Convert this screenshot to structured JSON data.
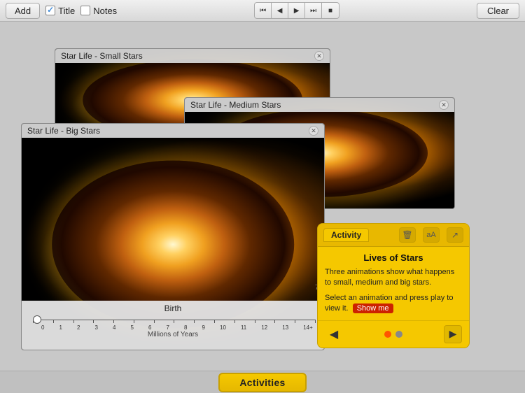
{
  "toolbar": {
    "add_label": "Add",
    "title_label": "Title",
    "notes_label": "Notes",
    "clear_label": "Clear",
    "title_checked": true,
    "notes_checked": false
  },
  "nav": {
    "buttons": [
      "⏮",
      "◀",
      "▶",
      "⏭",
      "⏹"
    ]
  },
  "panels": {
    "small": {
      "title": "Star Life - Small Stars"
    },
    "medium": {
      "title": "Star Life - Medium Stars"
    },
    "big": {
      "title": "Star Life - Big Stars",
      "timeline": {
        "label": "Birth",
        "axis_label": "Millions of Years",
        "ticks": [
          "0",
          "1",
          "2",
          "3",
          "4",
          "5",
          "6",
          "7",
          "8",
          "9",
          "10",
          "11",
          "12",
          "13",
          "14+"
        ]
      }
    }
  },
  "activity_popup": {
    "tab_label": "Activity",
    "title": "Lives of Stars",
    "description": "Three animations show what happens to small, medium and big stars.",
    "prompt": "Select an animation and press play to view it.",
    "show_me_label": "Show me",
    "footer": {
      "prev_label": "◀",
      "play_label": "▶"
    }
  },
  "bottom_bar": {
    "activities_label": "Activities"
  }
}
